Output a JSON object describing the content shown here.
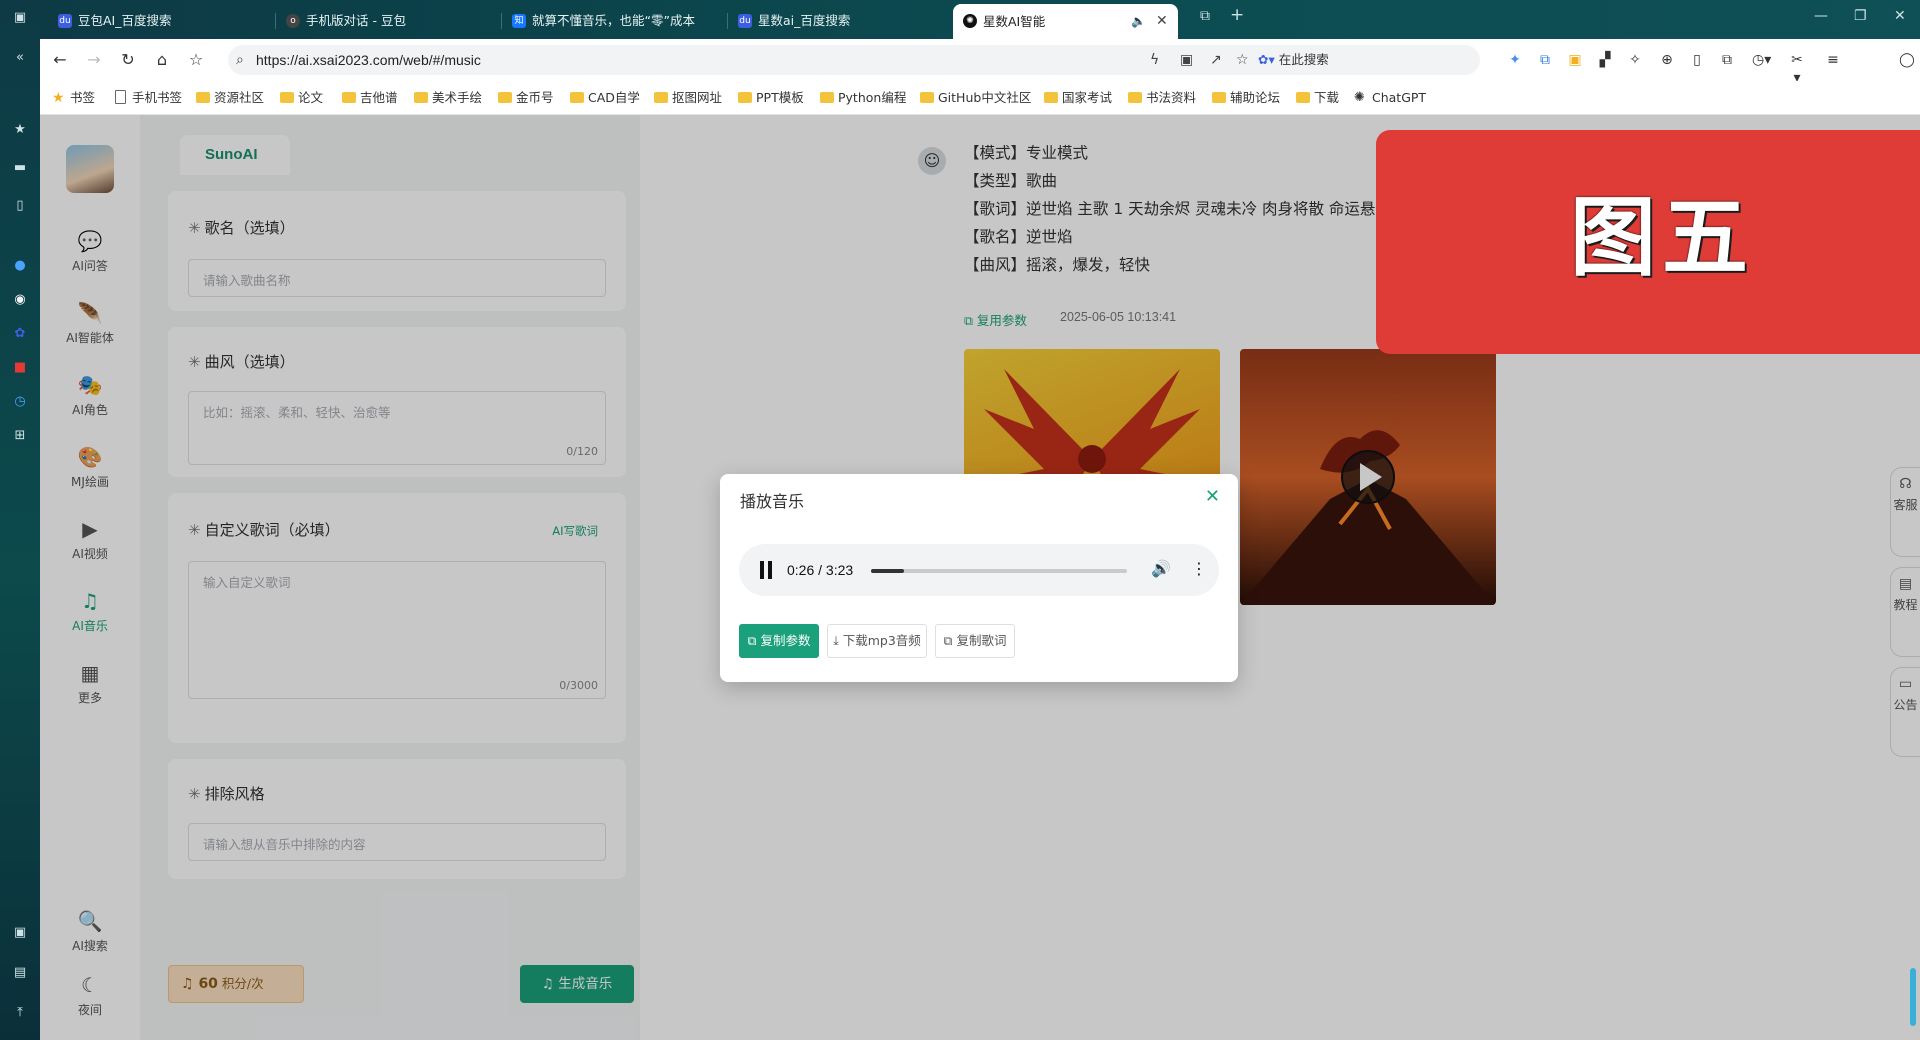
{
  "browser": {
    "tabs": [
      {
        "title": "豆包AI_百度搜索",
        "color": "#3b5fe0",
        "glyph": "du"
      },
      {
        "title": "手机版对话 - 豆包",
        "color": "#444",
        "glyph": "o"
      },
      {
        "title": "就算不懂音乐，也能“零”成本",
        "color": "#1677ff",
        "glyph": "知"
      },
      {
        "title": "星数ai_百度搜索",
        "color": "#3b5fe0",
        "glyph": "du"
      },
      {
        "title": "星数AI智能",
        "color": "#111",
        "glyph": "✺"
      }
    ],
    "url": "https://ai.xsai2023.com/web/#/music",
    "search_placeholder": "在此搜索",
    "bookmarks": [
      "书签",
      "手机书签",
      "资源社区",
      "论文",
      "吉他谱",
      "美术手绘",
      "金币号",
      "CAD自学",
      "抠图网址",
      "PPT模板",
      "Python编程",
      "GitHub中文社区",
      "国家考试",
      "书法资料",
      "辅助论坛",
      "下载",
      "ChatGPT"
    ]
  },
  "nav": {
    "items": [
      {
        "label": "AI问答",
        "icon": "💬"
      },
      {
        "label": "AI智能体",
        "icon": "🪶"
      },
      {
        "label": "AI角色",
        "icon": "🎭"
      },
      {
        "label": "MJ绘画",
        "icon": "🎨"
      },
      {
        "label": "AI视频",
        "icon": "▶"
      },
      {
        "label": "AI音乐",
        "icon": "♫"
      },
      {
        "label": "更多",
        "icon": "▦"
      }
    ],
    "bottom": [
      {
        "label": "AI搜索",
        "icon": "🔍"
      },
      {
        "label": "夜间",
        "icon": "☾"
      }
    ]
  },
  "form": {
    "tab": "SunoAI",
    "song_name": {
      "label": "歌名（选填）",
      "placeholder": "请输入歌曲名称"
    },
    "style": {
      "label": "曲风（选填）",
      "placeholder": "比如：摇滚、柔和、轻快、治愈等",
      "count": "0/120"
    },
    "lyrics": {
      "label": "自定义歌词（必填）",
      "ai_write": "AI写歌词",
      "placeholder": "输入自定义歌词",
      "count": "0/3000"
    },
    "exclude": {
      "label": "排除风格",
      "placeholder": "请输入想从音乐中排除的内容"
    },
    "points_value": "60",
    "points_unit": "积分/次",
    "generate": "生成音乐"
  },
  "result": {
    "lines": [
      "【模式】专业模式",
      "【类型】歌曲",
      "【歌词】逆世焰 主歌 1 天劫余烬 灵魂未冷 肉身将散 命运悬分 才",
      "【歌名】逆世焰",
      "【曲风】摇滚，爆发，轻快"
    ],
    "reuse": "复用参数",
    "time": "2025-06-05 10:13:41"
  },
  "side_tabs": [
    "客服",
    "教程",
    "公告"
  ],
  "modal": {
    "title": "播放音乐",
    "time_display": "0:26 / 3:23",
    "progress": 0.13,
    "buttons": [
      "复制参数",
      "下载mp3音频",
      "复制歌词"
    ]
  },
  "watermark": "图五",
  "colors": {
    "accent": "#1aa07a",
    "watermark": "#e03c37"
  }
}
